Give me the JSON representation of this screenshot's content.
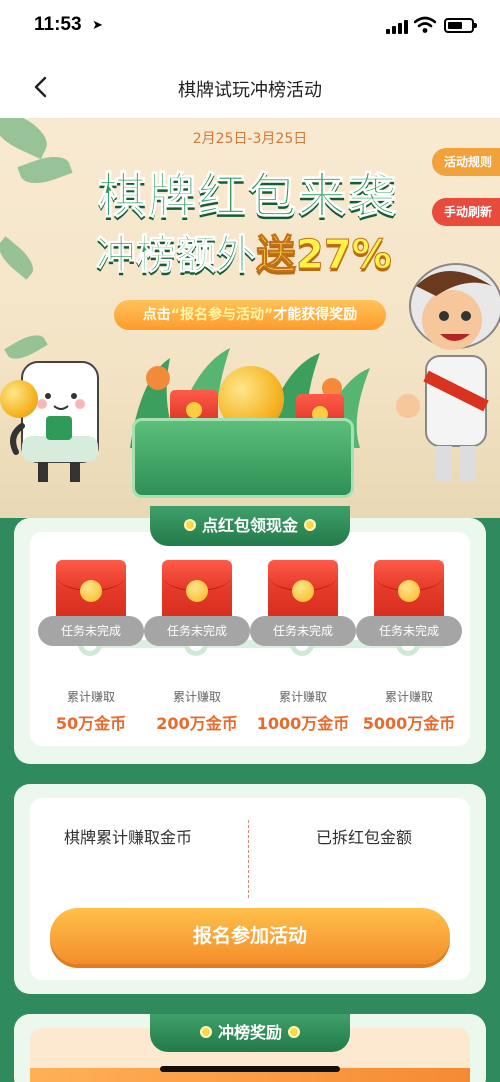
{
  "status_bar": {
    "time": "11:53"
  },
  "nav": {
    "title": "棋牌试玩冲榜活动"
  },
  "hero": {
    "date_range": "2月25日-3月25日",
    "title_line1": "棋牌红包来袭",
    "title_line2_prefix": "冲榜额外",
    "title_line2_highlight": "送27%",
    "subtitle_prefix": "点击",
    "subtitle_quote": "“报名参与活动”",
    "subtitle_suffix": "才能获得奖励",
    "side_rules": "活动规则",
    "side_refresh": "手动刷新"
  },
  "red_packet_section": {
    "tab_label": "点红包领现金",
    "rewards": [
      {
        "status": "任务未完成",
        "earn_label": "累计赚取",
        "amount": "50万金币"
      },
      {
        "status": "任务未完成",
        "earn_label": "累计赚取",
        "amount": "200万金币"
      },
      {
        "status": "任务未完成",
        "earn_label": "累计赚取",
        "amount": "1000万金币"
      },
      {
        "status": "任务未完成",
        "earn_label": "累计赚取",
        "amount": "5000万金币"
      }
    ]
  },
  "stats_section": {
    "left_label": "棋牌累计赚取金币",
    "right_label": "已拆红包金额",
    "join_button": "报名参加活动"
  },
  "ranking_section": {
    "tab_label": "冲榜奖励"
  },
  "colors": {
    "primary_green": "#2f8a5d",
    "accent_orange": "#f38e2a",
    "amount_orange": "#ea6a2d",
    "status_gray": "#a5a5a5"
  }
}
